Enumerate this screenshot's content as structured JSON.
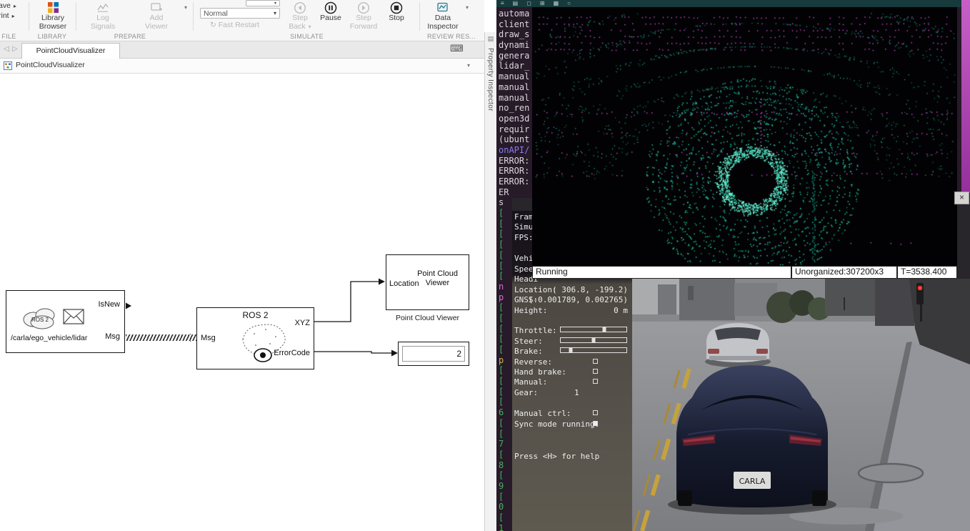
{
  "simulink": {
    "icons": {
      "caret": "▾",
      "submenu": "▸",
      "nav_back": "◁",
      "nav_forward": "▷",
      "keyboard": "⌨",
      "pi_tab": "▤",
      "fast_restart": "↻"
    },
    "file_save": "Save",
    "file_print": "Print",
    "file_section": "FILE",
    "library_browser_l1": "Library",
    "library_browser_l2": "Browser",
    "library_section": "LIBRARY",
    "log_signals_l1": "Log",
    "log_signals_l2": "Signals",
    "add_viewer_l1": "Add",
    "add_viewer_l2": "Viewer",
    "prepare_section": "PREPARE",
    "sim_mode": "Normal",
    "fast_restart": "Fast Restart",
    "step_back_l1": "Step",
    "step_back_l2": "Back",
    "pause": "Pause",
    "step_forward_l1": "Step",
    "step_forward_l2": "Forward",
    "stop": "Stop",
    "simulate_section": "SIMULATE",
    "data_inspector_l1": "Data",
    "data_inspector_l2": "Inspector",
    "review_section": "REVIEW RES...",
    "tab_title": "PointCloudVisualizer",
    "breadcrumb": "PointCloudVisualizer",
    "property_inspector": "Property Inspector",
    "blocks": {
      "sub_icon_text": "ROS 2",
      "sub_topic": "/carla/ego_vehicle/lidar",
      "sub_port_isnew": "IsNew",
      "sub_port_msg": "Msg",
      "ros2_title": "ROS 2",
      "ros2_port_msg": "Msg",
      "ros2_port_xyz": "XYZ",
      "ros2_port_error": "ErrorCode",
      "viewer_title_l1": "Point Cloud",
      "viewer_title_l2": "Viewer",
      "viewer_port": "Location",
      "viewer_caption": "Point Cloud Viewer",
      "display_value": "2"
    }
  },
  "terminal": {
    "lines": [
      {
        "t": "automa"
      },
      {
        "t": "client"
      },
      {
        "t": "draw_s"
      },
      {
        "t": "dynami"
      },
      {
        "t": "genera"
      },
      {
        "t": "lidar_"
      },
      {
        "t": "manual"
      },
      {
        "t": "manual"
      },
      {
        "t": "manual"
      },
      {
        "t": "no_ren"
      },
      {
        "t": "open3d"
      },
      {
        "t": "requir"
      },
      {
        "t": "(ubunt"
      },
      {
        "t": "onAPI/",
        "c": "#8b7bf0"
      },
      {
        "t": "ERROR:"
      },
      {
        "t": "ERROR:"
      },
      {
        "t": "ERROR:"
      },
      {
        "t": "ER"
      },
      {
        "t": "s"
      },
      {
        "t": "[",
        "c": "#44b45e"
      },
      {
        "t": "[",
        "c": "#44b45e"
      },
      {
        "t": "[",
        "c": "#44b45e"
      },
      {
        "t": "[",
        "c": "#44b45e"
      },
      {
        "t": "[",
        "c": "#44b45e"
      },
      {
        "t": "[",
        "c": "#44b45e"
      },
      {
        "t": "[",
        "c": "#44b45e"
      },
      {
        "t": "n",
        "c": "#d96ad9"
      },
      {
        "t": "p",
        "c": "#d96ad9"
      },
      {
        "t": "[",
        "c": "#44b45e"
      },
      {
        "t": "[",
        "c": "#44b45e"
      },
      {
        "t": "[",
        "c": "#44b45e"
      },
      {
        "t": "[",
        "c": "#44b45e"
      },
      {
        "t": "[",
        "c": "#44b45e"
      },
      {
        "t": "p",
        "c": "#c9b54d"
      },
      {
        "t": "[",
        "c": "#44b45e"
      },
      {
        "t": "[",
        "c": "#44b45e"
      },
      {
        "t": "[",
        "c": "#44b45e"
      },
      {
        "t": "[",
        "c": "#44b45e"
      },
      {
        "t": "6",
        "c": "#44b45e"
      },
      {
        "t": "[",
        "c": "#44b45e"
      },
      {
        "t": "[",
        "c": "#44b45e"
      },
      {
        "t": "7",
        "c": "#44b45e"
      },
      {
        "t": "[",
        "c": "#44b45e"
      },
      {
        "t": "8",
        "c": "#44b45e"
      },
      {
        "t": "[",
        "c": "#44b45e"
      },
      {
        "t": "9",
        "c": "#44b45e"
      },
      {
        "t": "[",
        "c": "#44b45e"
      },
      {
        "t": "0",
        "c": "#44b45e"
      },
      {
        "t": "[",
        "c": "#44b45e"
      },
      {
        "t": "1",
        "c": "#44b45e"
      }
    ]
  },
  "pointcloud": {
    "menubar_icons": [
      "≡",
      "▤",
      "◻",
      "⊞",
      "▦",
      "○"
    ],
    "status": {
      "running": "Running",
      "format": "Unorganized:307200x3",
      "time": "T=3538.400"
    },
    "viz": {
      "bg": "#020204",
      "grid_color": "#e14ae1",
      "ring_color": "#20c9a6",
      "center_x": 0.517,
      "center_y": 0.668,
      "rings": 14,
      "min_r": 34,
      "max_r": 148,
      "grid_rows_top": [
        14,
        23,
        32,
        41,
        50,
        59
      ],
      "grid_rows_mid": [
        148,
        176,
        204,
        234
      ],
      "wall_radii": [
        200,
        240,
        290,
        340,
        400,
        460
      ]
    }
  },
  "carla": {
    "close_glyph": "×",
    "license_plate": "CARLA",
    "hud": {
      "frame": "Frame",
      "simul": "Simul",
      "fps": "FPS:",
      "vehic": "Vehic",
      "speed": "Speed",
      "headi": "Headi",
      "location_label": "Location:",
      "location_value": "( 306.8, -199.2)",
      "gnss_label": "GNSS:",
      "gnss_value": "(-0.001789, 0.002765)",
      "height_label": "Height:",
      "height_value": "0 m",
      "throttle_label": "Throttle:",
      "throttle": 0.66,
      "steer_label": "Steer:",
      "steer": 0.5,
      "brake_label": "Brake:",
      "brake": 0.15,
      "reverse_label": "Reverse:",
      "reverse": false,
      "handbrake_label": "Hand brake:",
      "handbrake": false,
      "manual_label": "Manual:",
      "manual": false,
      "gear_label": "Gear:",
      "gear_value": "1",
      "manual_ctrl_label": "Manual ctrl:",
      "manual_ctrl": false,
      "sync_label": "Sync mode running:",
      "sync": true,
      "help": "Press <H> for help"
    }
  }
}
